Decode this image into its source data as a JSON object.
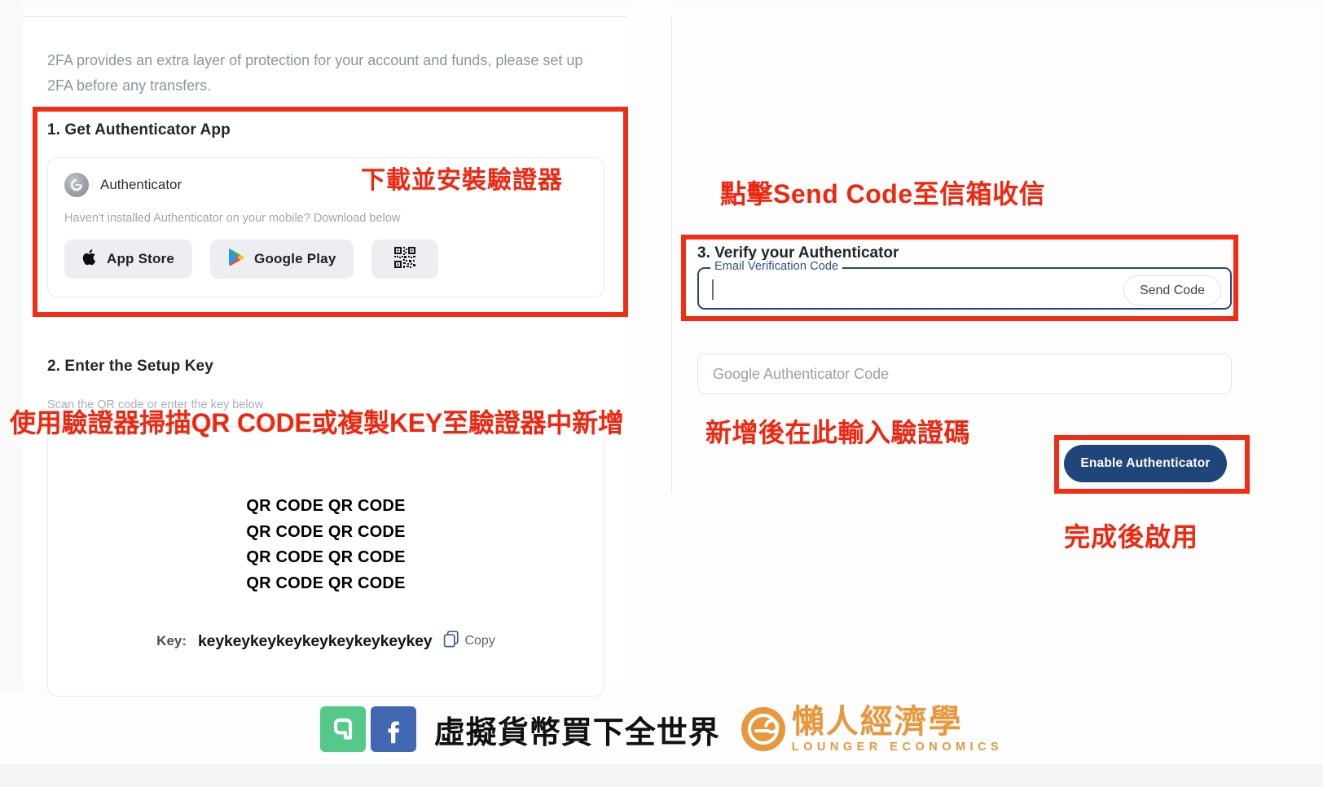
{
  "intro": {
    "text": "2FA provides an extra layer of protection for your account and funds, please set up 2FA before any transfers."
  },
  "section1": {
    "title": "1. Get Authenticator App",
    "app_name": "Authenticator",
    "app_icon": "authenticator-icon",
    "subtitle": "Haven't installed Authenticator on your mobile? Download below",
    "buttons": [
      {
        "label": "App Store",
        "icon": "apple-icon"
      },
      {
        "label": "Google Play",
        "icon": "google-play-icon"
      },
      {
        "label": "",
        "icon": "qr-code-icon"
      }
    ]
  },
  "section2": {
    "title": "2. Enter the Setup Key",
    "subtitle": "Scan the QR code or enter the key below",
    "qr_lines": [
      "QR CODE QR CODE",
      "QR CODE QR CODE",
      "QR CODE QR CODE",
      "QR CODE QR CODE"
    ],
    "key_label": "Key:",
    "key_value": "keykeykeykeykeykeykeykeykey",
    "copy_label": "Copy",
    "copy_icon": "copy-icon"
  },
  "section3": {
    "title": "3. Verify your Authenticator",
    "email_field": {
      "legend": "Email Verification Code",
      "value": "",
      "placeholder": ""
    },
    "send_code_label": "Send Code",
    "ga_field": {
      "placeholder": "Google Authenticator Code",
      "value": ""
    },
    "enable_label": "Enable Authenticator"
  },
  "annotations": [
    {
      "id": "note-download-app",
      "text": "下載並安裝驗證器"
    },
    {
      "id": "note-send-code",
      "text": "點擊Send Code至信箱收信"
    },
    {
      "id": "note-scan-qr",
      "text": "使用驗證器掃描QR CODE或複製KEY至驗證器中新增"
    },
    {
      "id": "note-enter-code",
      "text": "新增後在此輸入驗證碼"
    },
    {
      "id": "note-enable",
      "text": "完成後啟用"
    }
  ],
  "footer": {
    "tagline": "虛擬貨幣買下全世界",
    "brand_name": "懶人經濟學",
    "brand_sub": "LOUNGER ECONOMICS",
    "icons": [
      {
        "name": "line-icon",
        "color": "#54c98a"
      },
      {
        "name": "facebook-icon",
        "color": "#4267b2"
      }
    ]
  },
  "colors": {
    "annotation_red": "#f22d15",
    "primary_blue": "#20457b",
    "field_blue": "#24457c",
    "brand_orange": "#e8973d"
  }
}
